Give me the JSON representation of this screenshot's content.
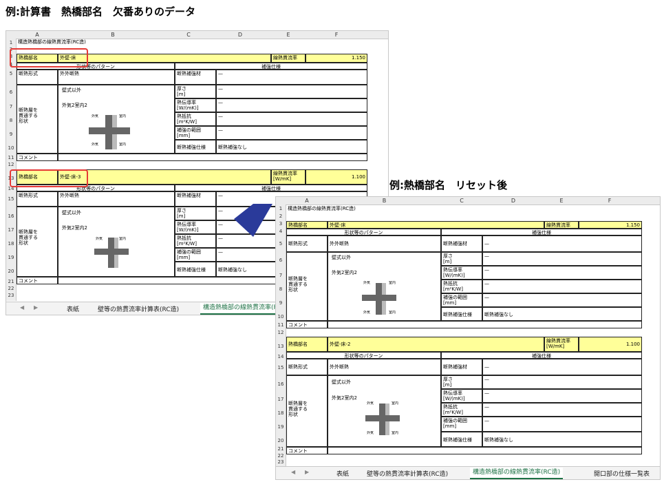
{
  "caption_top": "例:計算書　熱橋部名　欠番ありのデータ",
  "caption_right": "例:熱橋部名　リセット後",
  "columns": [
    "A",
    "B",
    "C",
    "D",
    "E",
    "F"
  ],
  "sheet_title": "構造熱橋部の線熱貫流率(RC造)",
  "labels": {
    "bridge_name": "熱橋部名",
    "psi": "線熱貫流率",
    "psi_unit": "線熱貫流率\n[W/mK]",
    "shape_pattern": "形状等のパターン",
    "reinforce_spec": "補強仕様",
    "insulation_type": "断熱形式",
    "insulation_type_value": "外外断熱",
    "reinforce_material": "断熱補強材",
    "thickness": "厚さ\n[m]",
    "conductivity": "熱伝導率\n[W/(mK)]",
    "resistance": "熱抵抗\n[m²K/W]",
    "range": "補強の範囲\n[mm]",
    "reinforce_spec_value_label": "断熱補強仕様",
    "no_reinforce": "断熱補強なし",
    "penetrating": "断熱層を\n貫通する\n形状",
    "wall_other": "壁式以外",
    "outer2_inner2": "外気2室内2",
    "comment": "コメント",
    "dash": "—",
    "outside": "外気",
    "inside": "室内"
  },
  "left_sheet": {
    "block1": {
      "name": "外壁-床",
      "psi": "1.150"
    },
    "block2": {
      "name": "外壁-床-3",
      "psi": "1.100"
    }
  },
  "right_sheet": {
    "block1": {
      "name": "外壁-床",
      "psi": "1.150"
    },
    "block2": {
      "name": "外壁-床-2",
      "psi": "1.100"
    }
  },
  "tabs": [
    "表紙",
    "壁等の熱貫流率計算表(RC造)",
    "構造熱橋部の線熱貫流率(RC造)",
    "開口部の仕様一覧表"
  ],
  "colors": {
    "yellow": "#ffff99",
    "red": "#e53935",
    "active_tab": "#1e7145",
    "diamond": "#2a3a9a"
  }
}
